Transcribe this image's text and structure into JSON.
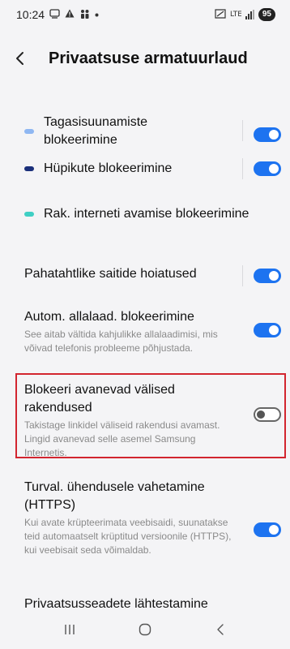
{
  "status_bar": {
    "time": "10:24",
    "left_icons": [
      "cast-icon",
      "warning-icon",
      "people-icon",
      "dot-icon"
    ],
    "battery": "95"
  },
  "header": {
    "title": "Privaatsuse armatuurlaud"
  },
  "settings": [
    {
      "title": "Tagasisuunamiste blokeerimine",
      "dot_color": "#8fb7f2",
      "enabled": true
    },
    {
      "title": "Hüpikute blokeerimine",
      "dot_color": "#1a2f7a",
      "enabled": true
    },
    {
      "title": "Rak. interneti avamise blokeerimine",
      "dot_color": "#3fcfc4"
    },
    {
      "title": "Pahatahtlike saitide hoiatused",
      "enabled": true
    },
    {
      "title": "Autom. allalaad. blokeerimine",
      "desc": "See aitab vältida kahjulikke allalaadimisi, mis võivad telefonis probleeme põhjustada.",
      "enabled": true
    },
    {
      "title": "Blokeeri avanevad välised rakendused",
      "desc": "Takistage linkidel väliseid rakendusi avamast. Lingid avanevad selle asemel Samsung Internetis.",
      "enabled": false
    },
    {
      "title": "Turval. ühendusele vahetamine (HTTPS)",
      "desc": "Kui avate krüpteerimata veebisaidi, suunatakse teid automaatselt krüptitud versioonile (HTTPS), kui veebisait seda võimaldab.",
      "enabled": true
    },
    {
      "title": "Privaatsusseadete lähtestamine"
    }
  ],
  "colors": {
    "accent": "#1d73f0",
    "highlight": "#d2252f"
  }
}
